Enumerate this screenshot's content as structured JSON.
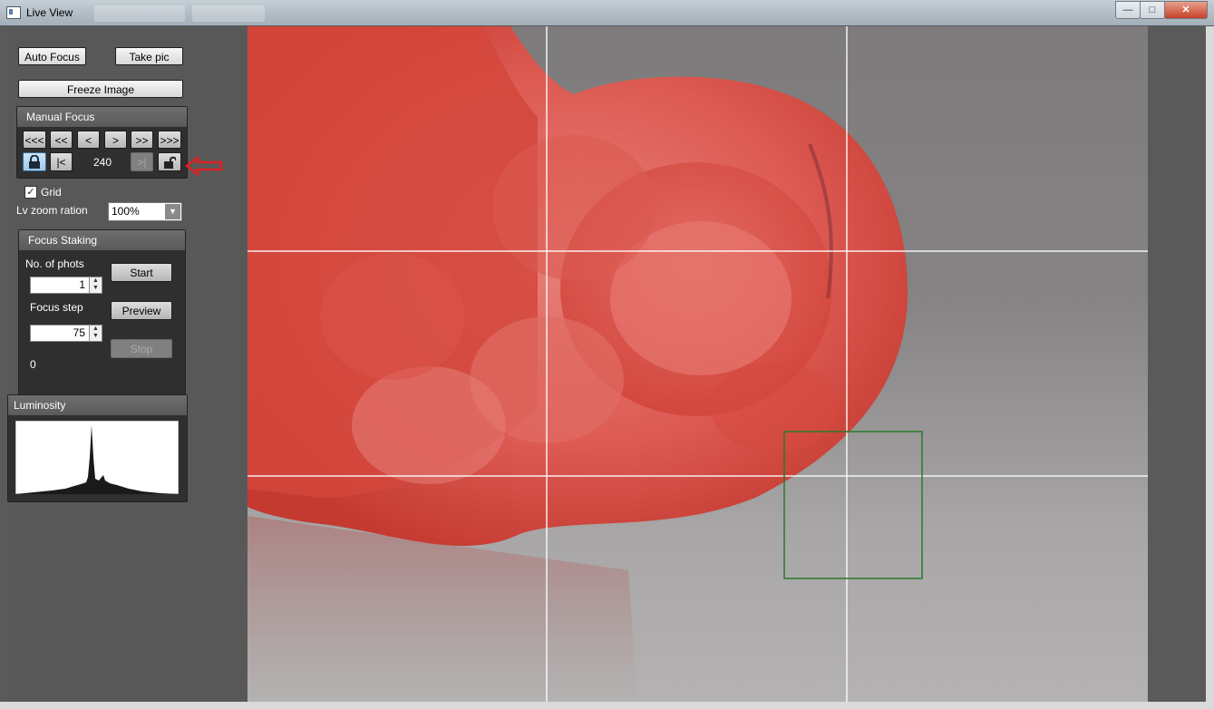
{
  "window": {
    "title": "Live View",
    "controls": {
      "minimize": "—",
      "maximize": "□",
      "close": "✕"
    }
  },
  "toolbar": {
    "auto_focus": "Auto Focus",
    "take_pic": "Take pic",
    "freeze_image": "Freeze Image"
  },
  "manual_focus": {
    "title": "Manual Focus",
    "buttons_row1": [
      "<<<",
      "<<",
      "<",
      ">",
      ">>",
      ">>>"
    ],
    "to_start": "|<",
    "to_end": ">|",
    "value": "240",
    "lock_icon_left": "lock-icon",
    "lock_icon_right": "unlock-icon"
  },
  "grid": {
    "label": "Grid",
    "checked": true,
    "check_mark": "✓"
  },
  "zoom": {
    "label": "Lv zoom ration",
    "value": "100%",
    "arrow": "▼"
  },
  "focus_stacking": {
    "title": "Focus Staking",
    "photos_label": "No. of phots",
    "photos_value": "1",
    "step_label": "Focus step",
    "step_value": "75",
    "start": "Start",
    "preview": "Preview",
    "stop": "Stop",
    "counter": "0"
  },
  "luminosity": {
    "title": "Luminosity"
  },
  "colors": {
    "annotation_arrow": "#e02020",
    "focus_box": "#2a7a2a",
    "grid_lines": "#ffffff"
  }
}
